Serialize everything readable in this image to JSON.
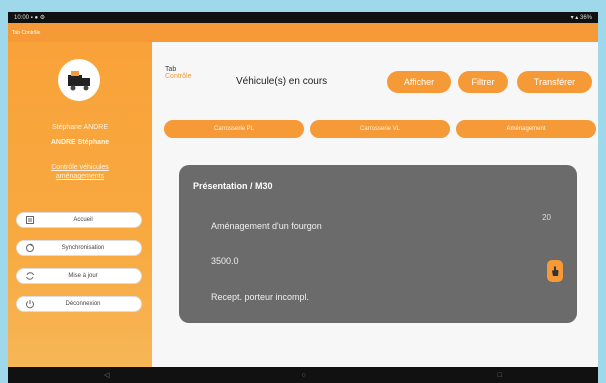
{
  "status_bar": {
    "left": "10:00 ▪ ● ⚙",
    "right": "▾ ▴ 36%"
  },
  "app_bar": {
    "title": "Tab Contrôle"
  },
  "sidebar": {
    "user_line1": "Stéphane ANDRE",
    "user_line2": "ANDRE Stéphane",
    "user_line3": "Contrôle véhicules",
    "user_line4": "aménagements",
    "items": [
      {
        "label": "Accueil",
        "icon": "home-icon"
      },
      {
        "label": "Synchronisation",
        "icon": "sync-icon"
      },
      {
        "label": "Mise à jour",
        "icon": "refresh-icon"
      },
      {
        "label": "Déconnexion",
        "icon": "power-icon"
      }
    ]
  },
  "header": {
    "logo_top": "Tab",
    "logo_bottom": "Contrôle",
    "title": "Véhicule(s) en cours",
    "buttons": {
      "afficher": "Afficher",
      "filtrer": "Filtrer",
      "transferer": "Transférer"
    }
  },
  "filters": [
    "Carrosserie PL",
    "Carrosserie VL",
    "Aménagement"
  ],
  "card": {
    "title": "Présentation / M30",
    "line1": "Aménagement d'un fourgon",
    "line2": "3500.0",
    "line3": "Recept. porteur incompl.",
    "count": "20"
  },
  "colors": {
    "accent": "#f59a36",
    "card": "#6b6b6b",
    "bg": "#9fd8ea"
  }
}
